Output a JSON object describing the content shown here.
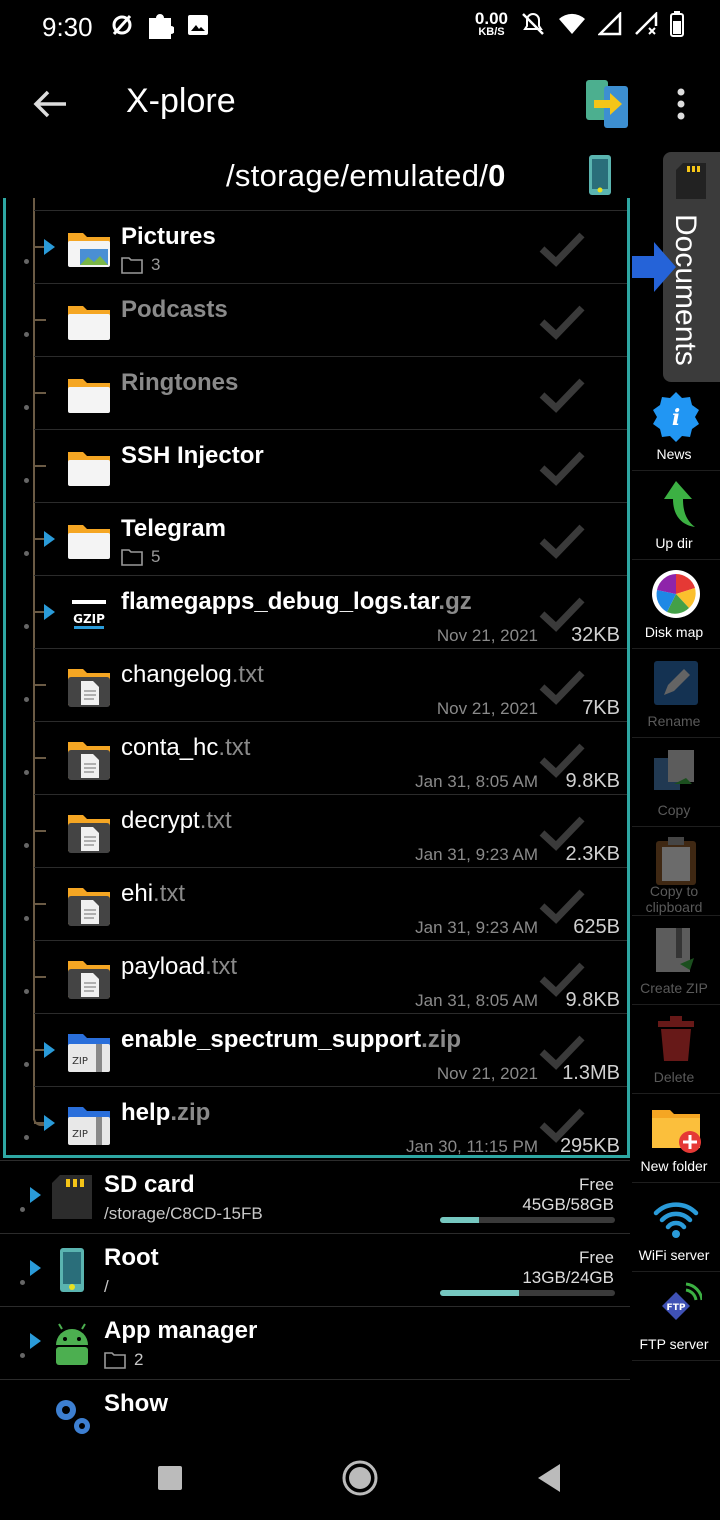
{
  "status": {
    "time": "9:30",
    "net_speed": "0.00",
    "net_unit": "KB/S"
  },
  "app": {
    "title": "X-plore"
  },
  "path": {
    "prefix": "/storage/emulated/",
    "last": "0"
  },
  "files": [
    {
      "name": "Pictures",
      "ext": "",
      "kind": "folder-pictures",
      "expandable": true,
      "count": "3",
      "style": "bold"
    },
    {
      "name": "Podcasts",
      "ext": "",
      "kind": "folder",
      "expandable": false,
      "style": "dim"
    },
    {
      "name": "Ringtones",
      "ext": "",
      "kind": "folder",
      "expandable": false,
      "style": "dim"
    },
    {
      "name": "SSH Injector",
      "ext": "",
      "kind": "folder",
      "expandable": false,
      "style": "bold"
    },
    {
      "name": "Telegram",
      "ext": "",
      "kind": "folder",
      "expandable": true,
      "count": "5",
      "style": "bold"
    },
    {
      "name": "flamegapps_debug_logs.tar",
      "ext": ".gz",
      "kind": "gzip",
      "expandable": true,
      "date": "Nov 21, 2021",
      "size": "32KB",
      "style": "bold"
    },
    {
      "name": "changelog",
      "ext": ".txt",
      "kind": "txt",
      "expandable": false,
      "date": "Nov 21, 2021",
      "size": "7KB",
      "style": "plain"
    },
    {
      "name": "conta_hc",
      "ext": ".txt",
      "kind": "txt",
      "expandable": false,
      "date": "Jan 31, 8:05 AM",
      "size": "9.8KB",
      "style": "plain"
    },
    {
      "name": "decrypt",
      "ext": ".txt",
      "kind": "txt",
      "expandable": false,
      "date": "Jan 31, 9:23 AM",
      "size": "2.3KB",
      "style": "plain"
    },
    {
      "name": "ehi",
      "ext": ".txt",
      "kind": "txt",
      "expandable": false,
      "date": "Jan 31, 9:23 AM",
      "size": "625B",
      "style": "plain"
    },
    {
      "name": "payload",
      "ext": ".txt",
      "kind": "txt",
      "expandable": false,
      "date": "Jan 31, 8:05 AM",
      "size": "9.8KB",
      "style": "plain"
    },
    {
      "name": "enable_spectrum_support",
      "ext": ".zip",
      "kind": "zip",
      "expandable": true,
      "date": "Nov 21, 2021",
      "size": "1.3MB",
      "style": "bold"
    },
    {
      "name": "help",
      "ext": ".zip",
      "kind": "zip",
      "expandable": true,
      "date": "Jan 30, 11:15 PM",
      "size": "295KB",
      "style": "bold"
    }
  ],
  "devices": [
    {
      "name": "SD card",
      "path": "/storage/C8CD-15FB",
      "free_label": "Free",
      "free": "45GB/58GB",
      "used_fraction": 0.22,
      "kind": "sdcard"
    },
    {
      "name": "Root",
      "path": "/",
      "free_label": "Free",
      "free": "13GB/24GB",
      "used_fraction": 0.45,
      "kind": "phone"
    },
    {
      "name": "App manager",
      "count": "2",
      "kind": "android"
    },
    {
      "name": "Show",
      "kind": "gears"
    }
  ],
  "sidebar": {
    "tab_label": "Documents",
    "items": [
      {
        "label": "News",
        "icon": "info-icon",
        "enabled": true
      },
      {
        "label": "Up dir",
        "icon": "up-arrow-icon",
        "enabled": true
      },
      {
        "label": "Disk map",
        "icon": "pie-chart-icon",
        "enabled": true
      },
      {
        "label": "Rename",
        "icon": "pencil-icon",
        "enabled": false
      },
      {
        "label": "Copy",
        "icon": "copy-icon",
        "enabled": false
      },
      {
        "label": "Copy to clipboard",
        "icon": "clipboard-icon",
        "enabled": false
      },
      {
        "label": "Create ZIP",
        "icon": "zip-icon",
        "enabled": false
      },
      {
        "label": "Delete",
        "icon": "trash-icon",
        "enabled": false
      },
      {
        "label": "New folder",
        "icon": "new-folder-icon",
        "enabled": true
      },
      {
        "label": "WiFi server",
        "icon": "wifi-icon",
        "enabled": true
      },
      {
        "label": "FTP server",
        "icon": "ftp-icon",
        "enabled": true
      }
    ]
  },
  "colors": {
    "panel_border": "#2ea7a3",
    "expand_arrow": "#2a9bd9",
    "folder": "#f5a623"
  }
}
